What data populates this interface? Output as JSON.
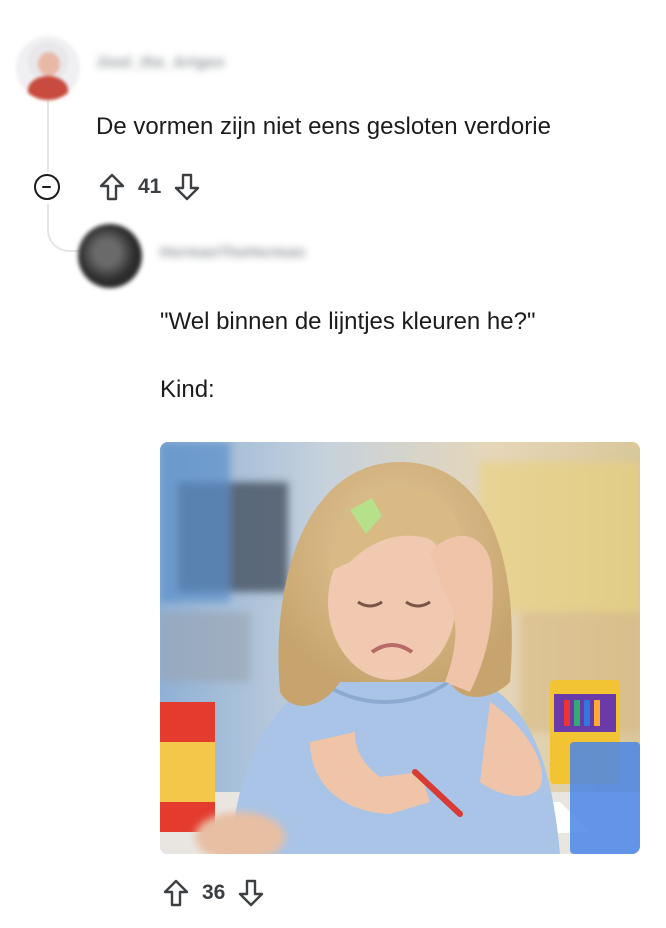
{
  "comments": [
    {
      "username": "Jisel_the_Artgeo",
      "text": "De vormen zijn niet eens gesloten verdorie",
      "votes": "41"
    },
    {
      "username": "HermanTheHerman",
      "text_line1": "\"Wel binnen de lijntjes kleuren he?\"",
      "text_line2": "Kind:",
      "image_icon": "photo-crying-girl-coloring",
      "votes": "36"
    }
  ],
  "icons": {
    "upvote": "arrow-up-icon",
    "downvote": "arrow-down-icon",
    "collapse": "minus-circle-icon"
  },
  "colors": {
    "text": "#1c1c1c",
    "muted": "#8a8f93",
    "thread": "#e3e6e8"
  }
}
